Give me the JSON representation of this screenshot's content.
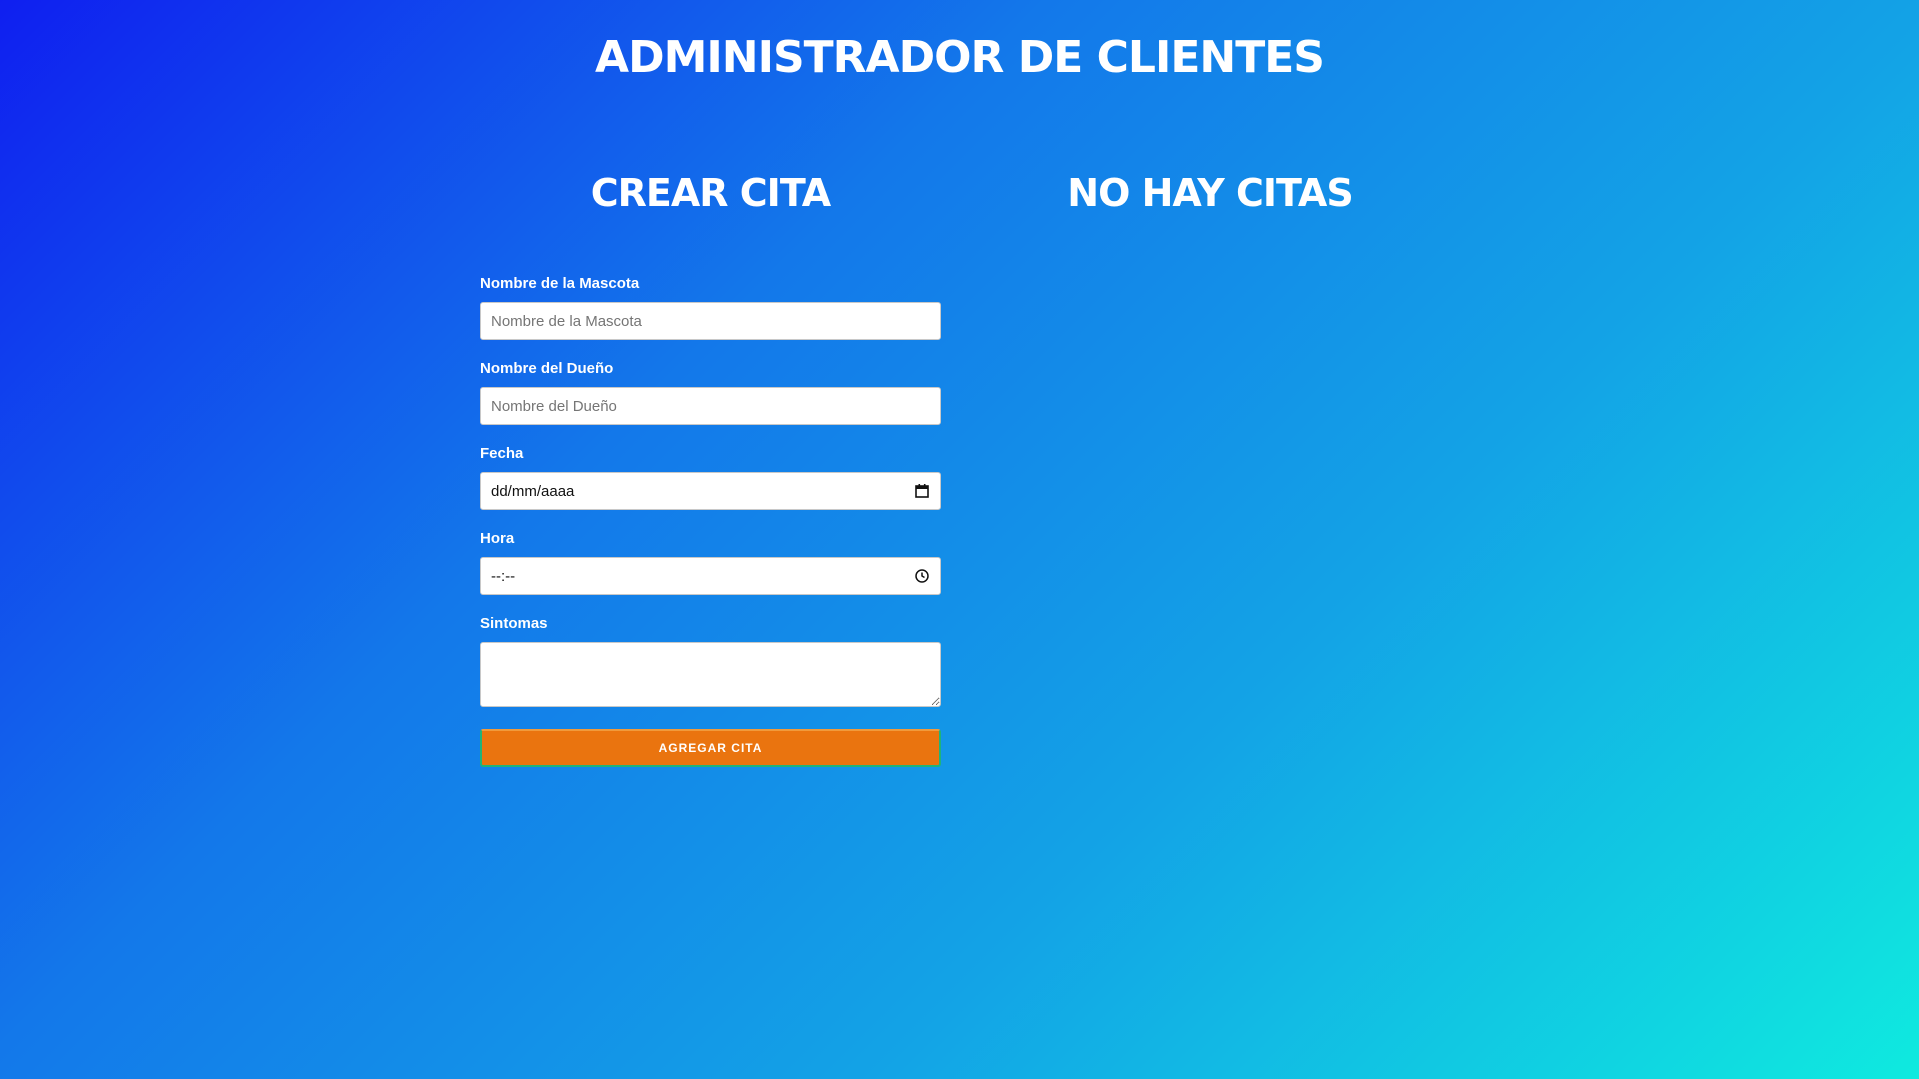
{
  "header": {
    "title": "Administrador de Clientes"
  },
  "form": {
    "title": "Crear Cita",
    "fields": [
      {
        "label": "Nombre de la Mascota",
        "placeholder": "Nombre de la Mascota",
        "value": ""
      },
      {
        "label": "Nombre del Dueño",
        "placeholder": "Nombre del Dueño",
        "value": ""
      },
      {
        "label": "Fecha",
        "display": "dd/mm/aaaa",
        "icon": "calendar-icon"
      },
      {
        "label": "Hora",
        "display": "--:--",
        "icon": "clock-icon"
      },
      {
        "label": "Sintomas",
        "value": ""
      }
    ],
    "submit_label": "Agregar Cita"
  },
  "appointments": {
    "empty_title": "No hay citas"
  },
  "colors": {
    "background_start": "#0f1ff0",
    "background_end": "#0feadf",
    "submit_button": "#ea740f",
    "text": "#ffffff"
  }
}
